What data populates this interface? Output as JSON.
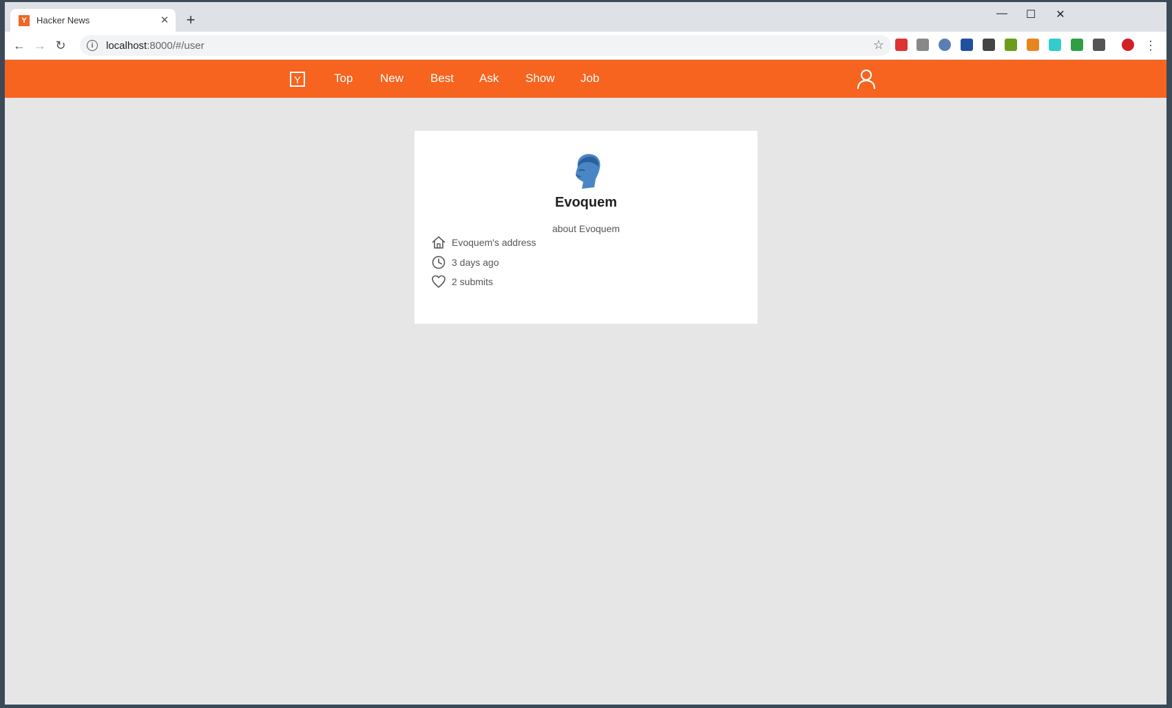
{
  "browser": {
    "tab_title": "Hacker News",
    "favicon_letter": "Y",
    "url_host": "localhost",
    "url_path": ":8000/#/user"
  },
  "header": {
    "logo_letter": "Y",
    "nav": [
      "Top",
      "New",
      "Best",
      "Ask",
      "Show",
      "Job"
    ],
    "color": "#f6641f"
  },
  "profile": {
    "name": "Evoquem",
    "about": "about Evoquem",
    "address": "Evoquem's address",
    "created": "3 days ago",
    "submits": "2 submits"
  },
  "icons": {
    "address": "home-icon",
    "created": "clock-icon",
    "submits": "heart-icon"
  }
}
